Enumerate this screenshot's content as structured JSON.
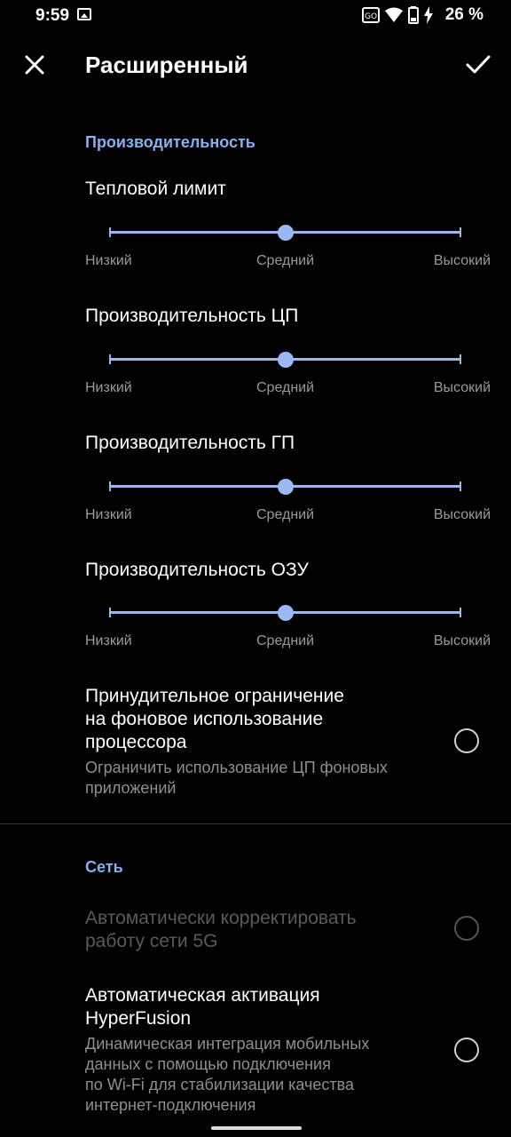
{
  "status_bar": {
    "time": "9:59",
    "battery_percent": "26 %",
    "icons": [
      "image-icon",
      "data-saver-icon",
      "wifi-icon",
      "battery-icon",
      "bolt-icon"
    ]
  },
  "app_bar": {
    "title": "Расширенный",
    "close_icon": "close-icon",
    "confirm_icon": "check-icon"
  },
  "performance": {
    "header": "Производительность",
    "sliders": [
      {
        "title": "Тепловой лимит",
        "low": "Низкий",
        "mid": "Средний",
        "high": "Высокий",
        "value": "mid",
        "fraction": 0.5
      },
      {
        "title": "Производительность ЦП",
        "low": "Низкий",
        "mid": "Средний",
        "high": "Высокий",
        "value": "mid",
        "fraction": 0.5
      },
      {
        "title": "Производительность ГП",
        "low": "Низкий",
        "mid": "Средний",
        "high": "Высокий",
        "value": "mid",
        "fraction": 0.5
      },
      {
        "title": "Производительность ОЗУ",
        "low": "Низкий",
        "mid": "Средний",
        "high": "Высокий",
        "value": "mid",
        "fraction": 0.5
      }
    ],
    "background_limit": {
      "title_line1": "Принудительное ограничение",
      "title_line2": "на фоновое использование",
      "title_line3": "процессора",
      "desc_line1": "Ограничить использование ЦП фоновых",
      "desc_line2": "приложений",
      "checked": false
    }
  },
  "network": {
    "header": "Сеть",
    "auto_5g": {
      "title_line1": "Автоматически корректировать",
      "title_line2": "работу сети 5G",
      "enabled": false,
      "checked": false
    },
    "hyperfusion": {
      "title_line1": "Автоматическая активация",
      "title_line2": "HyperFusion",
      "desc_line1": "Динамическая интеграция мобильных",
      "desc_line2": "данных с помощью подключения",
      "desc_line3": "по Wi-Fi для стабилизации качества",
      "desc_line4": "интернет-подключения",
      "checked": false
    }
  },
  "colors": {
    "accent": "#8aaef0",
    "slider": "#9ab8f4",
    "background": "#000000"
  }
}
